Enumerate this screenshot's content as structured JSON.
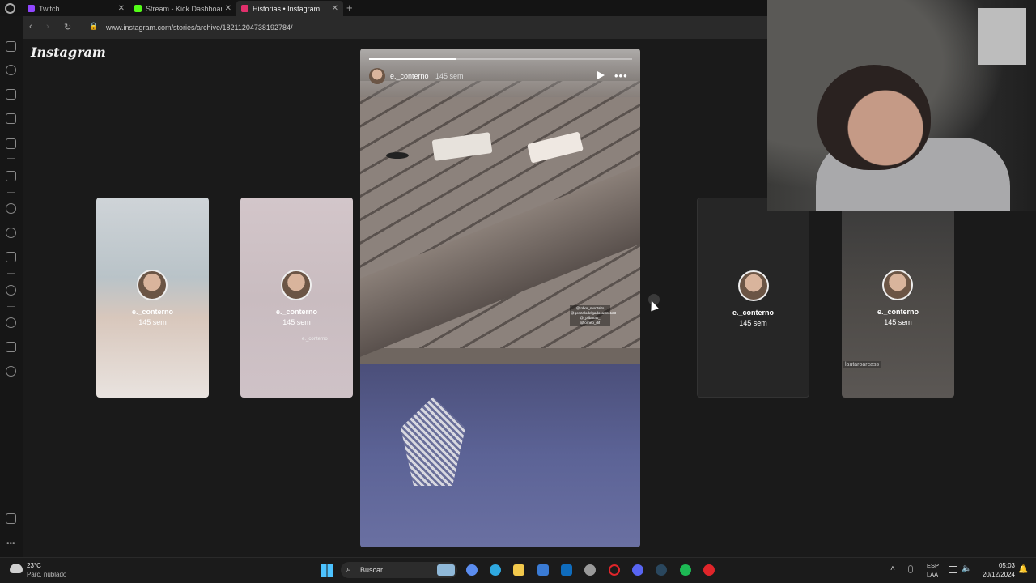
{
  "browser": {
    "tabs": [
      {
        "title": "Twitch",
        "favicon_color": "#9146ff"
      },
      {
        "title": "Stream - Kick Dashboard",
        "favicon_color": "#53fc18"
      },
      {
        "title": "Historias • Instagram",
        "favicon_color": "#e1306c"
      }
    ],
    "new_tab": "+",
    "close": "✕",
    "url": "www.instagram.com/stories/archive/18211204738192784/"
  },
  "instagram": {
    "logo": "Instagram",
    "story": {
      "username": "e._conterno",
      "time": "145 sem",
      "progress": 0.33,
      "more": "•••",
      "mention": "@tobor_montalto @gonzalodelgadocastro123 @_pilbarak_ @jorneo_dif"
    },
    "side_stories": [
      {
        "username": "e._conterno",
        "time": "145 sem"
      },
      {
        "username": "e._conterno",
        "time": "145 sem",
        "tag": "e._conterno"
      },
      {
        "username": "e._conterno",
        "time": "145 sem"
      },
      {
        "username": "e._conterno",
        "time": "145 sem",
        "tag": "lautaroarcass"
      }
    ]
  },
  "taskbar": {
    "weather_temp": "23°C",
    "weather_desc": "Parc. nublado",
    "search_label": "Buscar",
    "search_glyph": "⌕",
    "tray_up": "˄",
    "lang_line1": "ESP",
    "lang_line2": "LAA",
    "volume_glyph": "🔈",
    "clock_time": "05:03",
    "clock_date": "20/12/2024",
    "bell_glyph": "🔔",
    "pinned": [
      "photos-icon",
      "copilot-icon",
      "edge-icon",
      "file-explorer-icon",
      "store-icon",
      "outlook-icon",
      "chrome-icon",
      "opera-icon",
      "discord-icon",
      "steam-icon",
      "spotify-icon",
      "app-icon"
    ],
    "pinned_colors": [
      "#8fb8d8",
      "#5b8df0",
      "#2fa8e0",
      "#f2c94c",
      "#3a7bd5",
      "#0f6cbd",
      "#9a9a9a",
      "#e0252a",
      "#5865f2",
      "#2a475e",
      "#1db954",
      "#e0252a"
    ]
  },
  "sidebar": {
    "icons": [
      "controller-icon",
      "speed-dial-icon",
      "bag-icon",
      "twitch-icon",
      "calendar-icon",
      "aria-icon",
      "messenger-icon",
      "whatsapp-icon",
      "instagram-icon",
      "music-icon",
      "history-icon",
      "box-icon",
      "settings-icon",
      "capture-icon"
    ]
  }
}
